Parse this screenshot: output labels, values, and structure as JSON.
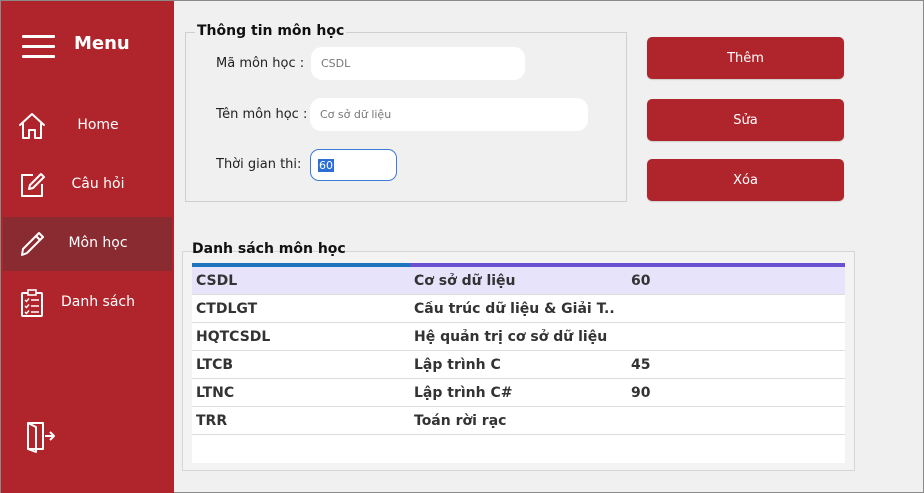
{
  "sidebar": {
    "menu_title": "Menu",
    "items": [
      {
        "label": "Home",
        "icon": "home-icon"
      },
      {
        "label": "Câu hỏi",
        "icon": "edit-icon"
      },
      {
        "label": "Môn học",
        "icon": "pencil-icon"
      },
      {
        "label": "Danh sách",
        "icon": "checklist-icon"
      }
    ],
    "active_item": "Môn học",
    "exit_icon": "exit-icon"
  },
  "form": {
    "title": "Thông tin môn học",
    "ma_label": "Mã môn học :",
    "ma_placeholder": "CSDL",
    "ten_label": "Tên môn học :",
    "ten_placeholder": "Cơ sở dữ liệu",
    "thoigian_label": "Thời gian thi:",
    "thoigian_value": "60"
  },
  "buttons": {
    "add": "Thêm",
    "edit": "Sửa",
    "delete": "Xóa"
  },
  "list": {
    "title": "Danh sách môn học",
    "rows": [
      [
        "CSDL",
        "Cơ sở dữ liệu",
        "60"
      ],
      [
        "CTDLGT",
        "Cấu trúc dữ liệu & Giải T...",
        ""
      ],
      [
        "HQTCSDL",
        "Hệ quản trị cơ sở dữ liệu",
        ""
      ],
      [
        "LTCB",
        "Lập trình C",
        "45"
      ],
      [
        "LTNC",
        "Lập trình C#",
        "90"
      ],
      [
        "TRR",
        "Toán rời rạc",
        ""
      ]
    ],
    "selected_row": 0
  },
  "colors": {
    "sidebar": "#b0252c",
    "active_item": "#8a2a31",
    "button": "#b0252c",
    "header_bar_left": "#1e73be",
    "header_bar_right": "#6a4fd0",
    "selected_row": "#e6e3fb"
  }
}
